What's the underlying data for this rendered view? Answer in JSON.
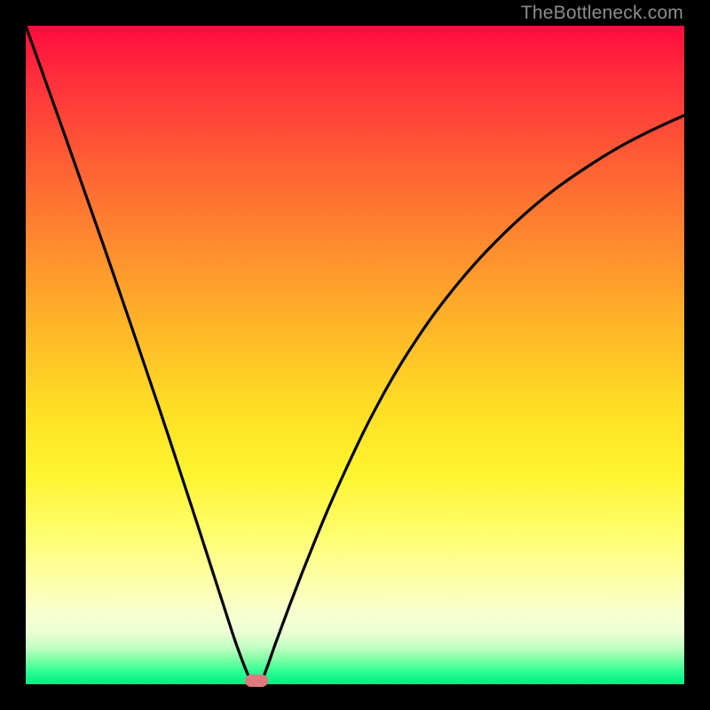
{
  "watermark": "TheBottleneck.com",
  "chart_data": {
    "type": "line",
    "title": "",
    "xlabel": "",
    "ylabel": "",
    "xlim": [
      0,
      100
    ],
    "ylim": [
      0,
      100
    ],
    "x": [
      0,
      2,
      4,
      6,
      8,
      10,
      12,
      14,
      16,
      18,
      20,
      22,
      24,
      26,
      28,
      30,
      32,
      34,
      35,
      36,
      38,
      40,
      42,
      44,
      46,
      48,
      50,
      52,
      55,
      58,
      62,
      66,
      70,
      75,
      80,
      85,
      90,
      95,
      100
    ],
    "y": [
      100,
      94.4,
      88.8,
      83.2,
      77.5,
      71.8,
      66.1,
      60.3,
      54.5,
      48.6,
      42.7,
      36.7,
      30.6,
      24.5,
      18.3,
      12.1,
      6.0,
      0.9,
      0.0,
      0.9,
      6.4,
      11.8,
      17.0,
      22.0,
      26.8,
      31.3,
      35.6,
      39.7,
      45.3,
      50.3,
      56.2,
      61.3,
      65.8,
      70.7,
      74.9,
      78.4,
      81.5,
      84.1,
      86.4
    ],
    "annotations": [
      {
        "type": "marker",
        "x": 35,
        "y": 0.5,
        "shape": "pill",
        "color": "#de7a7c"
      }
    ],
    "background_gradient": {
      "top_color": "#ff0b3e",
      "bottom_color": "#00ef82",
      "stops": [
        "red",
        "orange",
        "yellow",
        "cream",
        "green"
      ]
    }
  }
}
